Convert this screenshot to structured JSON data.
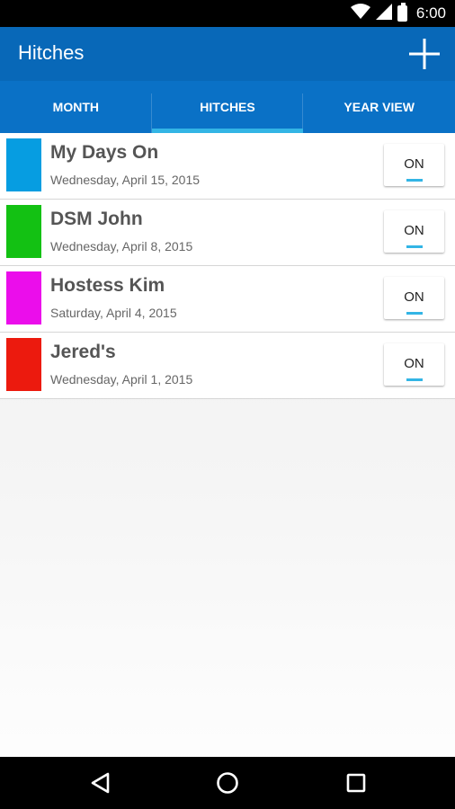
{
  "status_bar": {
    "time": "6:00",
    "icons": [
      "wifi-icon",
      "signal-icon",
      "battery-icon"
    ]
  },
  "app_bar": {
    "title": "Hitches",
    "add_icon": "plus-icon"
  },
  "tabs": [
    {
      "label": "MONTH",
      "active": false
    },
    {
      "label": "HITCHES",
      "active": true
    },
    {
      "label": "YEAR VIEW",
      "active": false
    }
  ],
  "hitches": [
    {
      "name": "My Days On",
      "date": "Wednesday, April 15, 2015",
      "color": "#069de1",
      "toggle": "ON"
    },
    {
      "name": "DSM John",
      "date": "Wednesday, April 8, 2015",
      "color": "#13c113",
      "toggle": "ON"
    },
    {
      "name": "Hostess Kim",
      "date": "Saturday, April 4, 2015",
      "color": "#eb0deb",
      "toggle": "ON"
    },
    {
      "name": "Jered's",
      "date": "Wednesday, April 1, 2015",
      "color": "#ec1a0e",
      "toggle": "ON"
    }
  ],
  "nav_bar": {
    "icons": [
      "back-icon",
      "home-icon",
      "recents-icon"
    ]
  },
  "colors": {
    "app_bar": "#0868b8",
    "tab_bar": "#0a71c6",
    "tab_indicator": "#33b5e5"
  }
}
